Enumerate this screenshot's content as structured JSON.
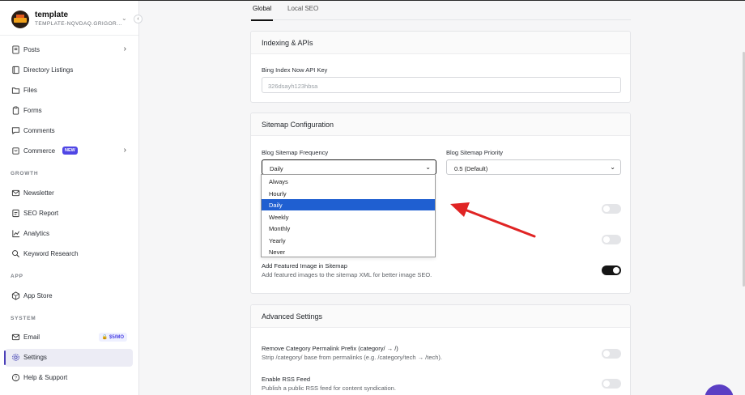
{
  "workspace": {
    "name": "template",
    "subtitle": "TEMPLATE-NQVDAQ.GRIGOR..."
  },
  "sidebar": {
    "items": [
      {
        "label": "Posts",
        "icon": "posts-icon"
      },
      {
        "label": "Directory Listings",
        "icon": "book-icon"
      },
      {
        "label": "Files",
        "icon": "folder-icon"
      },
      {
        "label": "Forms",
        "icon": "clipboard-icon"
      },
      {
        "label": "Comments",
        "icon": "comment-icon"
      },
      {
        "label": "Commerce",
        "icon": "cart-icon",
        "badge": "NEW"
      }
    ],
    "growth_heading": "GROWTH",
    "growth_items": [
      {
        "label": "Newsletter",
        "icon": "mail-icon"
      },
      {
        "label": "SEO Report",
        "icon": "report-icon"
      },
      {
        "label": "Analytics",
        "icon": "chart-icon"
      },
      {
        "label": "Keyword Research",
        "icon": "search-icon"
      }
    ],
    "app_heading": "APP",
    "app_items": [
      {
        "label": "App Store",
        "icon": "box-icon"
      }
    ],
    "system_heading": "SYSTEM",
    "system_items": [
      {
        "label": "Email",
        "icon": "mail-icon",
        "badge": "$5/MO"
      },
      {
        "label": "Settings",
        "icon": "gear-icon",
        "active": true
      },
      {
        "label": "Help & Support",
        "icon": "help-icon"
      }
    ]
  },
  "tabs": [
    {
      "label": "Global",
      "active": true
    },
    {
      "label": "Local SEO"
    }
  ],
  "indexing": {
    "title": "Indexing & APIs",
    "bing_label": "Bing Index Now API Key",
    "bing_value": "326dsayh123hbsa"
  },
  "sitemap": {
    "title": "Sitemap Configuration",
    "frequency_label": "Blog Sitemap Frequency",
    "frequency_value": "Daily",
    "priority_label": "Blog Sitemap Priority",
    "priority_value": "0.5 (Default)",
    "frequency_options": [
      "Always",
      "Hourly",
      "Daily",
      "Weekly",
      "Monthly",
      "Yearly",
      "Never"
    ],
    "selected_option": "Daily",
    "featured_title": "Add Featured Image in Sitemap",
    "featured_desc": "Add featured images to the sitemap XML for better image SEO.",
    "toggle1_on": false,
    "toggle2_on": false,
    "featured_on": true
  },
  "advanced": {
    "title": "Advanced Settings",
    "remove_prefix_title": "Remove Category Permalink Prefix (category/ → /)",
    "remove_prefix_desc": "Strip /category/ base from permalinks (e.g. /category/tech → /tech).",
    "rss_title": "Enable RSS Feed",
    "rss_desc": "Publish a public RSS feed for content syndication.",
    "remove_prefix_on": false,
    "rss_on": false
  },
  "colors": {
    "accent": "#4f46e5",
    "selection": "#1f5fd1",
    "arrow": "#e02424",
    "toggle_on": "#151515"
  }
}
